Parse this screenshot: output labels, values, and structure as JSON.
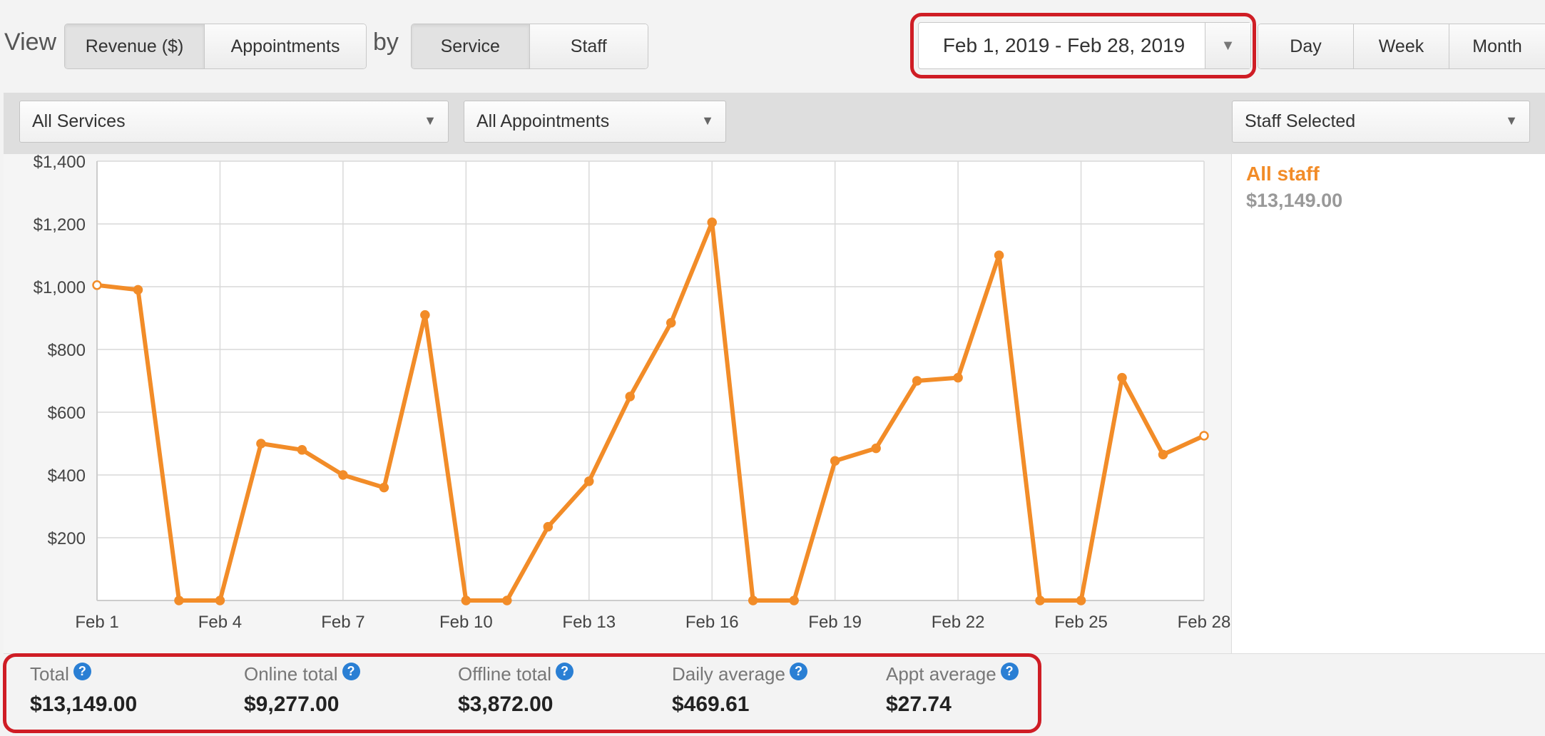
{
  "toolbar": {
    "view_label": "View",
    "by_label": "by",
    "metric_buttons": [
      "Revenue ($)",
      "Appointments"
    ],
    "dimension_buttons": [
      "Service",
      "Staff"
    ],
    "date_range": "Feb 1, 2019 - Feb 28, 2019",
    "period_buttons": [
      "Day",
      "Week",
      "Month"
    ]
  },
  "filters": {
    "services": "All Services",
    "appointments": "All Appointments",
    "staff": "Staff Selected"
  },
  "legend": {
    "name": "All staff",
    "value": "$13,149.00",
    "color": "#f28c28"
  },
  "stats": [
    {
      "label": "Total",
      "value": "$13,149.00"
    },
    {
      "label": "Online total",
      "value": "$9,277.00"
    },
    {
      "label": "Offline total",
      "value": "$3,872.00"
    },
    {
      "label": "Daily average",
      "value": "$469.61"
    },
    {
      "label": "Appt average",
      "value": "$27.74"
    }
  ],
  "chart_data": {
    "type": "line",
    "x": [
      "Feb 1",
      "Feb 2",
      "Feb 3",
      "Feb 4",
      "Feb 5",
      "Feb 6",
      "Feb 7",
      "Feb 8",
      "Feb 9",
      "Feb 10",
      "Feb 11",
      "Feb 12",
      "Feb 13",
      "Feb 14",
      "Feb 15",
      "Feb 16",
      "Feb 17",
      "Feb 18",
      "Feb 19",
      "Feb 20",
      "Feb 21",
      "Feb 22",
      "Feb 23",
      "Feb 24",
      "Feb 25",
      "Feb 26",
      "Feb 27",
      "Feb 28"
    ],
    "x_tick_labels": [
      "Feb 1",
      "Feb 4",
      "Feb 7",
      "Feb 10",
      "Feb 13",
      "Feb 16",
      "Feb 19",
      "Feb 22",
      "Feb 25",
      "Feb 28"
    ],
    "y_tick_labels": [
      "$200",
      "$400",
      "$600",
      "$800",
      "$1,000",
      "$1,200",
      "$1,400"
    ],
    "ylim": [
      0,
      1400
    ],
    "grid": true,
    "series": [
      {
        "name": "All staff",
        "color": "#f28c28",
        "values": [
          1005,
          990,
          0,
          0,
          500,
          480,
          400,
          360,
          910,
          0,
          0,
          235,
          380,
          650,
          885,
          1205,
          0,
          0,
          445,
          485,
          700,
          710,
          1100,
          0,
          0,
          710,
          465,
          525
        ]
      }
    ]
  }
}
